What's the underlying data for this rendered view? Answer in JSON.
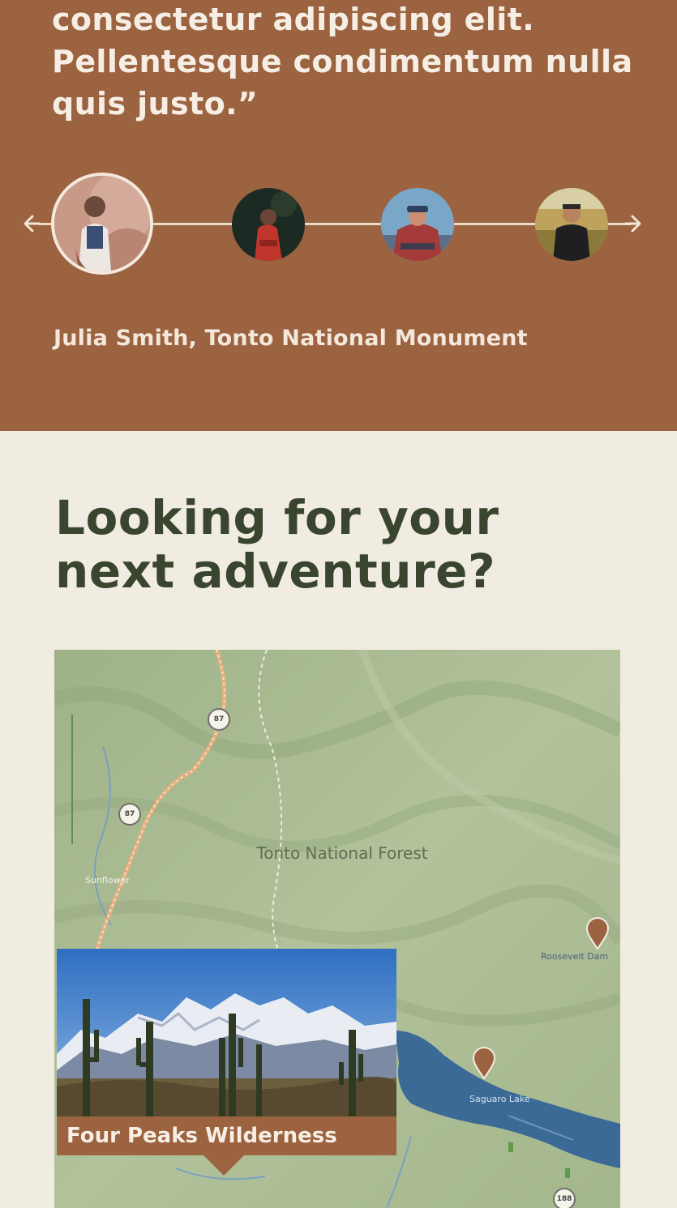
{
  "testimonial": {
    "quote": "consectetur adipiscing elit. Pellentesque condimentum nulla quis justo.”",
    "attribution": "Julia Smith, Tonto National Monument",
    "avatars": [
      {
        "name": "avatar-julia",
        "selected": true
      },
      {
        "name": "avatar-2",
        "selected": false
      },
      {
        "name": "avatar-3",
        "selected": false
      },
      {
        "name": "avatar-4",
        "selected": false
      }
    ],
    "prev_icon": "arrow-left-icon",
    "next_icon": "arrow-right-icon"
  },
  "adventure": {
    "heading": "Looking for your next adventure?",
    "map": {
      "forest_label": "Tonto National Forest",
      "town_label": "Sunflower",
      "lake_label": "Saguaro Lake",
      "pin_label": "Roosevelt Dam",
      "highway_shields": [
        "87",
        "87",
        "188"
      ],
      "colors": {
        "terrain": "#a9bb92",
        "water": "#3b6a96",
        "pin": "#9b6340",
        "road": "#e8b98a"
      }
    },
    "card": {
      "title": "Four Peaks Wilderness"
    }
  },
  "colors": {
    "brown": "#9b6340",
    "cream": "#f1ece1",
    "heading_green": "#3a4530"
  }
}
